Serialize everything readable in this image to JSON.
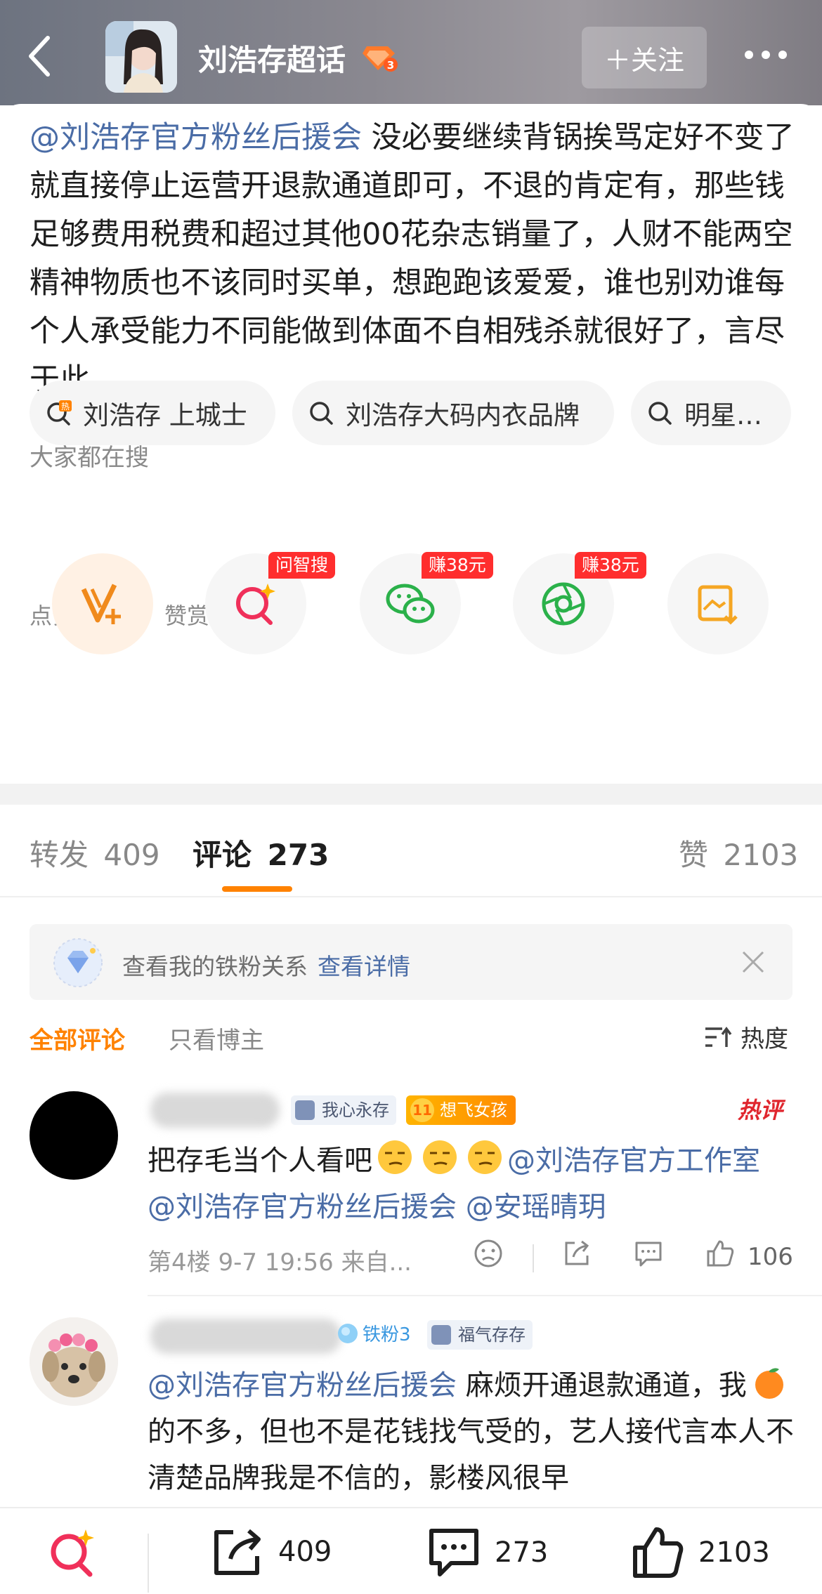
{
  "header": {
    "title": "刘浩存超话",
    "follow_label": "＋关注"
  },
  "post": {
    "mention": "@刘浩存官方粉丝后援会",
    "body": " 没必要继续背锅挨骂定好不变了就直接停止运营开退款通道即可，不退的肯定有，那些钱足够费用税费和超过其他00花杂志销量了，人财不能两空精神物质也不该同时买单，想跑跑该爱爱，谁也别劝谁每个人承受能力不同能做到体面不自相残杀就很好了，言尽于此。"
  },
  "search_section": {
    "label": "大家都在搜",
    "chips": [
      "刘浩存 上城士",
      "刘浩存大码内衣品牌",
      "明星…"
    ]
  },
  "reward_section": {
    "label": "点赞是美意，赞赏是鼓励",
    "tags": [
      "问智搜",
      "赚38元",
      "赚38元"
    ]
  },
  "tabs": {
    "repost_label": "转发",
    "repost_count": "409",
    "comment_label": "评论",
    "comment_count": "273",
    "like_label": "赞",
    "like_count": "2103"
  },
  "banner": {
    "text": "查看我的铁粉关系",
    "link": "查看详情"
  },
  "filters": {
    "all": "全部评论",
    "owner_only": "只看博主",
    "sort": "热度"
  },
  "comments": [
    {
      "badges": [
        "我心永存",
        "想飞女孩"
      ],
      "badge_level": "11",
      "hot_tag": "热评",
      "text_a": "把存毛当个人看吧",
      "text_b": "@刘浩存官方工作室 @刘浩存官方粉丝后援会 @安瑶晴玥",
      "meta": "第4楼 9-7 19:56 来自...",
      "likes": "106"
    },
    {
      "fan_badge": "铁粉3",
      "badge": "福气存存",
      "mention": "@刘浩存官方粉丝后援会",
      "text_a": " 麻烦开通退款通道，我",
      "text_b": "的不多，但也不是花钱找气受的，艺人接代言本人不清楚品牌我是不信的，影楼风很早"
    }
  ],
  "bottom_bar": {
    "repost": "409",
    "comment": "273",
    "like": "2103"
  },
  "colors": {
    "accent": "#ff8200",
    "link": "#4a6ca6",
    "hot": "#e0262e"
  }
}
